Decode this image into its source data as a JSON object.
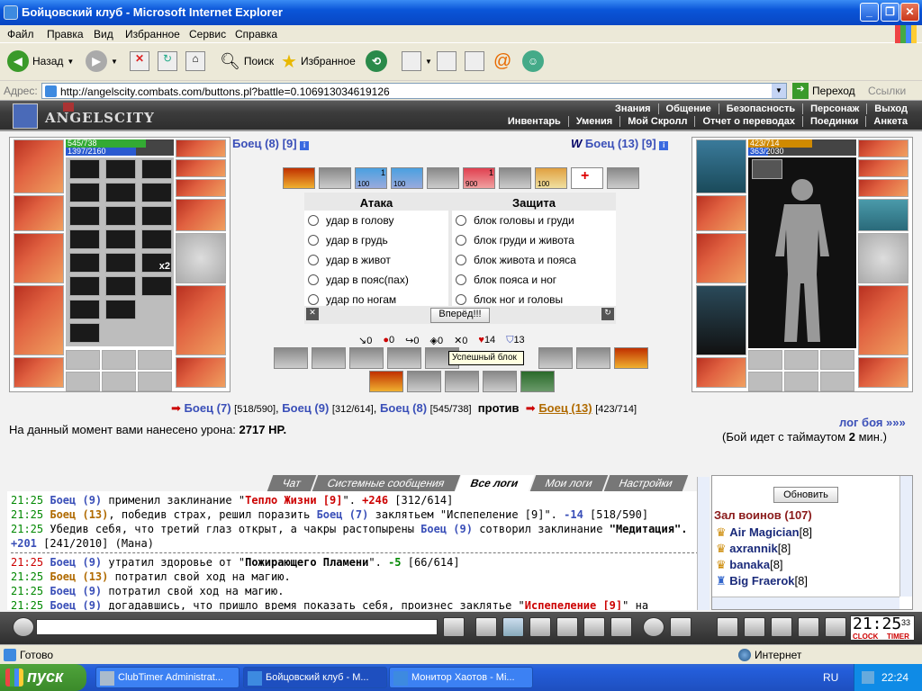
{
  "window": {
    "title": "Бойцовский клуб - Microsoft Internet Explorer"
  },
  "menu": [
    "Файл",
    "Правка",
    "Вид",
    "Избранное",
    "Сервис",
    "Справка"
  ],
  "toolbar": {
    "back": "Назад",
    "search": "Поиск",
    "favorites": "Избранное"
  },
  "address": {
    "label": "Адрес:",
    "url": "http://angelscity.combats.com/buttons.pl?battle=0.106913034619126",
    "go": "Переход",
    "links": "Ссылки"
  },
  "game": {
    "logo": "ANGELSCITY",
    "nav_top": [
      "Знания",
      "Общение",
      "Безопасность",
      "Персонаж",
      "Выход"
    ],
    "nav_bottom": [
      "Инвентарь",
      "Умения",
      "Мой Скролл",
      "Отчет о переводах",
      "Поединки",
      "Анкета"
    ],
    "left": {
      "name": "Боец (8)",
      "count": "[9]",
      "hp": "545/738",
      "mana": "1397/2160",
      "hp_frac": 0.74,
      "mana_frac": 0.65,
      "stack": "x2"
    },
    "right": {
      "name": "Боец (13)",
      "count": "[9]",
      "hp": "423/714",
      "mana": "363/2030",
      "hp_frac": 0.59,
      "mana_frac": 0.18
    },
    "skill_counts": [
      "1",
      "100",
      "100",
      "1",
      "900",
      "100"
    ],
    "attack": {
      "title": "Атака",
      "options": [
        "удар в голову",
        "удар в грудь",
        "удар в живот",
        "удар в пояс(пах)",
        "удар по ногам"
      ]
    },
    "defense": {
      "title": "Защита",
      "options": [
        "блок головы и груди",
        "блок груди и живота",
        "блок живота и пояса",
        "блок пояса и ног",
        "блок ног и головы"
      ]
    },
    "forward": "Вперёд!!!",
    "stats": [
      "0",
      "0",
      "0",
      "0",
      "0",
      "14",
      "13"
    ],
    "tooltip": "Успешный блок",
    "teams": {
      "f1": "Боец (7)",
      "f1v": "[518/590]",
      "f2": "Боец (9)",
      "f2v": "[312/614]",
      "f3": "Боец (8)",
      "f3v": "[545/738]",
      "vs": "против",
      "f4": "Боец (13)",
      "f4v": "[423/714]"
    },
    "damage_label": "На данный момент вами нанесено урона:",
    "damage_value": "2717 HP.",
    "battle_log_link": "лог боя »»»",
    "timeout_pre": "(Бой идет с таймаутом",
    "timeout_val": "2",
    "timeout_post": "мин.)",
    "tabs": [
      "Чат",
      "Системные сообщения",
      "Все логи",
      "Мои логи",
      "Настройки"
    ],
    "refresh": "Обновить",
    "hall": "Зал воинов (107)",
    "players": [
      {
        "name": "Air Magician",
        "lvl": "[8]"
      },
      {
        "name": "axrannik",
        "lvl": "[8]"
      },
      {
        "name": "banaka",
        "lvl": "[8]"
      },
      {
        "name": "Big Fraerok",
        "lvl": "[8]"
      }
    ],
    "log": [
      [
        "21:25",
        "Боец (9)",
        "применил заклинание \"",
        "Тепло Жизни [9]",
        "\". ",
        "+246",
        " [312/614]"
      ],
      [
        "21:25",
        "Боец (13)",
        ", победив страх, решил поразить ",
        "Боец (7)",
        "заклятьем \"Испепеление [9]\". ",
        "-14",
        " [518/590]"
      ],
      [
        "21:25",
        "Убедив себя, что третий глаз открыт, а чакры растопырены",
        "Боец (9)",
        "сотворил заклинание",
        "\"Медитация\". ",
        "+201",
        " [241/2010] (Мана)"
      ],
      [
        "21:25",
        "Боец (9)",
        "утратил здоровье от \"",
        "Пожирающего Пламени",
        "\". ",
        "-5",
        " [66/614]"
      ],
      [
        "21:25",
        "Боец (13)",
        "потратил свой ход на магию.",
        "",
        "",
        "",
        ""
      ],
      [
        "21:25",
        "Боец (9)",
        "потратил свой ход на магию.",
        "",
        "",
        "",
        ""
      ],
      [
        "21:25",
        "Боец (9)",
        "догадавшись, что пришло время показать себя, произнес заклятье \"",
        "Испепеление [9]",
        "\" на",
        "",
        ""
      ]
    ],
    "clock": "21:25",
    "clock_sec": "33",
    "clock_label1": "CLOCK",
    "clock_label2": "TIMER"
  },
  "status": {
    "left": "Готово",
    "zone": "Интернет"
  },
  "taskbar": {
    "start": "пуск",
    "tasks": [
      "ClubTimer Administrat...",
      "Бойцовский клуб - M...",
      "Монитор Хаотов - Mi..."
    ],
    "lang": "RU",
    "time": "22:24"
  }
}
